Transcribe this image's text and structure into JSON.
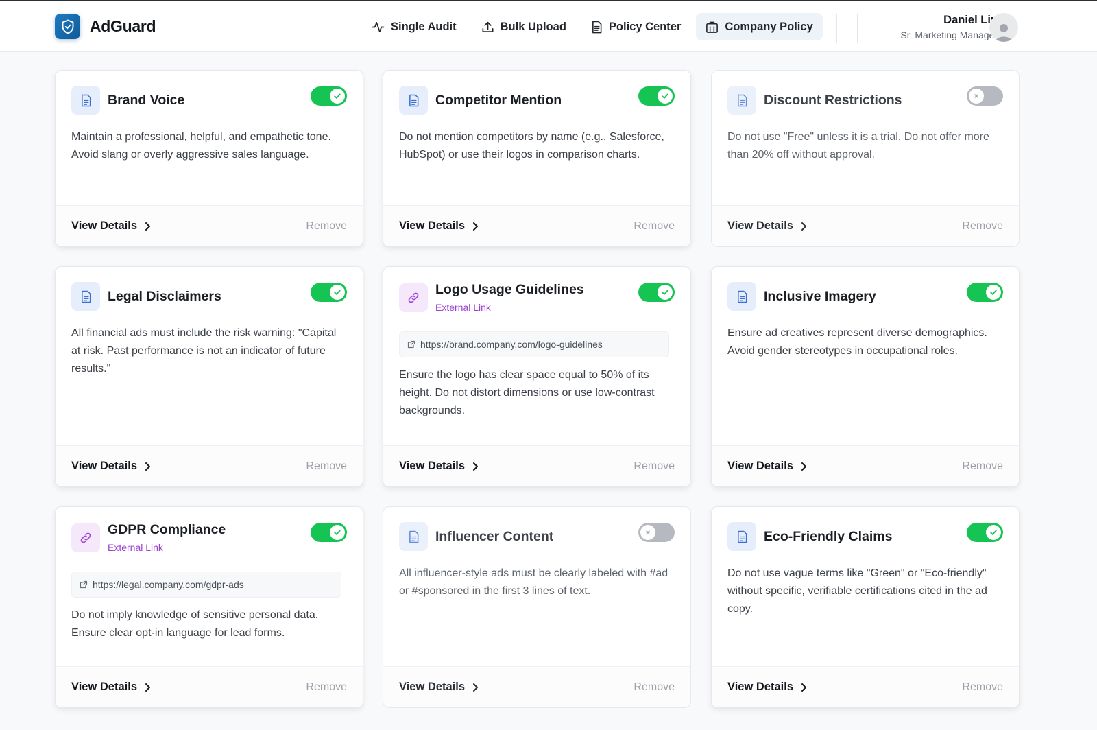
{
  "header": {
    "brand": "AdGuard",
    "nav": [
      {
        "label": "Single Audit",
        "icon": "activity-icon"
      },
      {
        "label": "Bulk Upload",
        "icon": "upload-icon"
      },
      {
        "label": "Policy Center",
        "icon": "document-icon"
      },
      {
        "label": "Company Policy",
        "icon": "building-icon",
        "active": true
      }
    ],
    "user": {
      "name": "Daniel Liu",
      "role": "Sr. Marketing Manager"
    }
  },
  "colors": {
    "brand": "#1677c1",
    "toggle_on": "#16c454",
    "toggle_off": "#b6b9bf",
    "external_link": "#9b3fd1"
  },
  "footer_labels": {
    "view_details": "View Details",
    "remove": "Remove"
  },
  "policies": [
    {
      "title": "Brand Voice",
      "enabled": true,
      "type": "document",
      "description": "Maintain a professional, helpful, and empathetic tone. Avoid slang or overly aggressive sales language."
    },
    {
      "title": "Competitor Mention",
      "enabled": true,
      "type": "document",
      "description": "Do not mention competitors by name (e.g., Salesforce, HubSpot) or use their logos in comparison charts."
    },
    {
      "title": "Discount Restrictions",
      "enabled": false,
      "type": "document",
      "description": "Do not use \"Free\" unless it is a trial. Do not offer more than 20% off without approval."
    },
    {
      "title": "Legal Disclaimers",
      "enabled": true,
      "type": "document",
      "description": "All financial ads must include the risk warning: \"Capital at risk. Past performance is not an indicator of future results.\""
    },
    {
      "title": "Logo Usage Guidelines",
      "enabled": true,
      "type": "link",
      "link_label": "External Link",
      "url": "https://brand.company.com/logo-guidelines",
      "description": "Ensure the logo has clear space equal to 50% of its height. Do not distort dimensions or use low-contrast backgrounds."
    },
    {
      "title": "Inclusive Imagery",
      "enabled": true,
      "type": "document",
      "description": "Ensure ad creatives represent diverse demographics. Avoid gender stereotypes in occupational roles."
    },
    {
      "title": "GDPR Compliance",
      "enabled": true,
      "type": "link",
      "link_label": "External Link",
      "url": "https://legal.company.com/gdpr-ads",
      "description": "Do not imply knowledge of sensitive personal data. Ensure clear opt-in language for lead forms."
    },
    {
      "title": "Influencer Content",
      "enabled": false,
      "type": "document",
      "description": "All influencer-style ads must be clearly labeled with #ad or #sponsored in the first 3 lines of text."
    },
    {
      "title": "Eco-Friendly Claims",
      "enabled": true,
      "type": "document",
      "description": "Do not use vague terms like \"Green\" or \"Eco-friendly\" without specific, verifiable certifications cited in the ad copy."
    }
  ]
}
